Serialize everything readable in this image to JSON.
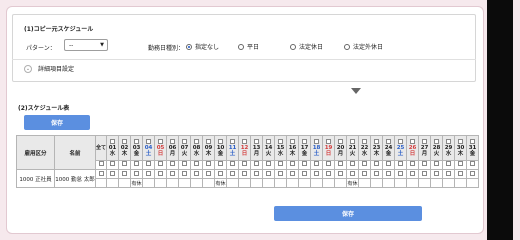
{
  "copy_section": {
    "title": "(1)コピー元スケジュール",
    "pattern_label": "パターン：",
    "pattern_value": "--",
    "workday_type_label": "勤務日種別：",
    "radios": [
      {
        "label": "指定なし",
        "checked": true
      },
      {
        "label": "平日",
        "checked": false
      },
      {
        "label": "法定休日",
        "checked": false
      },
      {
        "label": "法定外休日",
        "checked": false
      }
    ],
    "detail_label": "詳細項目設定"
  },
  "schedule_section": {
    "title": "(2)スケジュール表",
    "save_top": "保存",
    "save_bottom": "保存",
    "headers": {
      "employment_type": "雇用区分",
      "name": "名前",
      "select_all": "全て"
    },
    "days": [
      {
        "n": "01",
        "w": "水",
        "c": "weekday"
      },
      {
        "n": "02",
        "w": "木",
        "c": "weekday"
      },
      {
        "n": "03",
        "w": "金",
        "c": "weekday"
      },
      {
        "n": "04",
        "w": "土",
        "c": "sat"
      },
      {
        "n": "05",
        "w": "日",
        "c": "sun"
      },
      {
        "n": "06",
        "w": "月",
        "c": "weekday"
      },
      {
        "n": "07",
        "w": "火",
        "c": "weekday"
      },
      {
        "n": "08",
        "w": "水",
        "c": "weekday"
      },
      {
        "n": "09",
        "w": "木",
        "c": "weekday"
      },
      {
        "n": "10",
        "w": "金",
        "c": "weekday"
      },
      {
        "n": "11",
        "w": "土",
        "c": "sat"
      },
      {
        "n": "12",
        "w": "日",
        "c": "sun"
      },
      {
        "n": "13",
        "w": "月",
        "c": "weekday"
      },
      {
        "n": "14",
        "w": "火",
        "c": "weekday"
      },
      {
        "n": "15",
        "w": "水",
        "c": "weekday"
      },
      {
        "n": "16",
        "w": "木",
        "c": "weekday"
      },
      {
        "n": "17",
        "w": "金",
        "c": "weekday"
      },
      {
        "n": "18",
        "w": "土",
        "c": "sat"
      },
      {
        "n": "19",
        "w": "日",
        "c": "sun"
      },
      {
        "n": "20",
        "w": "月",
        "c": "weekday"
      },
      {
        "n": "21",
        "w": "火",
        "c": "weekday"
      },
      {
        "n": "22",
        "w": "水",
        "c": "weekday"
      },
      {
        "n": "23",
        "w": "木",
        "c": "weekday"
      },
      {
        "n": "24",
        "w": "金",
        "c": "weekday"
      },
      {
        "n": "25",
        "w": "土",
        "c": "sat"
      },
      {
        "n": "26",
        "w": "日",
        "c": "sun"
      },
      {
        "n": "27",
        "w": "月",
        "c": "weekday"
      },
      {
        "n": "28",
        "w": "火",
        "c": "weekday"
      },
      {
        "n": "29",
        "w": "水",
        "c": "weekday"
      },
      {
        "n": "30",
        "w": "木",
        "c": "weekday"
      },
      {
        "n": "31",
        "w": "金",
        "c": "weekday"
      }
    ],
    "rows": [
      {
        "employment_type": "1000 正社員",
        "name": "1000 勤怠 太郎",
        "day_values": [
          "",
          "",
          "有休",
          "",
          "",
          "",
          "",
          "",
          "",
          "有休",
          "",
          "",
          "",
          "",
          "",
          "",
          "",
          "",
          "",
          "",
          "有休",
          "",
          "",
          "",
          "",
          "",
          "",
          "",
          "",
          "",
          ""
        ]
      }
    ]
  },
  "colors": {
    "accent": "#5b8fe0",
    "saturday": "#2b5fc8",
    "sunday": "#d43c3c"
  }
}
